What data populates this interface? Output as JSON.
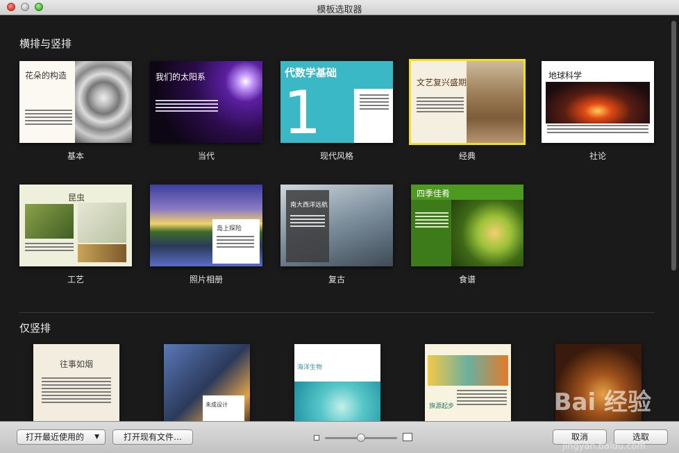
{
  "window": {
    "title": "模板选取器"
  },
  "sections": {
    "landscape": "横排与竖排",
    "portrait": "仅竖排"
  },
  "templates_row1": [
    {
      "label": "基本",
      "card_title": "花朵的构造"
    },
    {
      "label": "当代",
      "card_title": "我们的太阳系"
    },
    {
      "label": "现代风格",
      "card_title": "代数学基础"
    },
    {
      "label": "经典",
      "card_title": "文艺复兴盛期"
    },
    {
      "label": "社论",
      "card_title": "地球科学"
    }
  ],
  "templates_row2": [
    {
      "label": "工艺",
      "card_title": "昆虫"
    },
    {
      "label": "照片相册",
      "card_title": "岛上探险"
    },
    {
      "label": "复古",
      "card_title": "南大西洋远航"
    },
    {
      "label": "食谱",
      "card_title": "四季佳肴"
    }
  ],
  "templates_row3": [
    {
      "card_title": "往事如烟"
    },
    {
      "card_title": "未成设计"
    },
    {
      "card_title": "海洋生物"
    },
    {
      "card_title": "旗源起步"
    },
    {
      "card_title": ""
    }
  ],
  "buttons": {
    "open_recent": "打开最近使用的",
    "open_existing": "打开现有文件…",
    "cancel": "取消",
    "choose": "选取"
  },
  "zoom": {
    "level": 0.5
  },
  "watermark": {
    "main": "Bai 经验",
    "sub": "jingyan.baidu.com"
  },
  "colors": {
    "selection": "#f2e11b",
    "background": "#1a1a1a"
  }
}
